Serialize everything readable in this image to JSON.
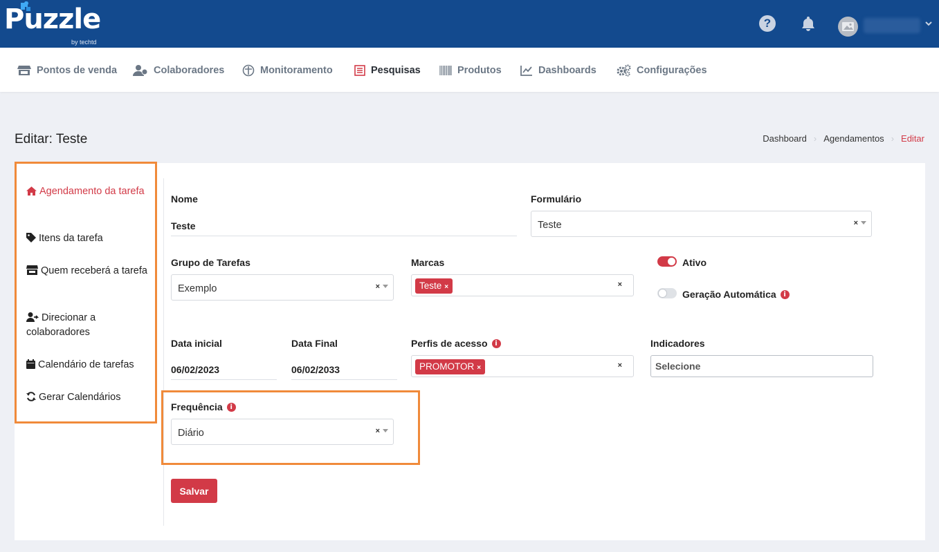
{
  "app": {
    "logo_text": "Puzzle",
    "logo_byline": "by techtd",
    "header_icons": [
      "help-icon",
      "bell-icon",
      "avatar",
      "chevron-down-icon"
    ],
    "help_glyph": "?"
  },
  "nav": {
    "items": [
      {
        "label": "Pontos de venda",
        "icon": "store-icon"
      },
      {
        "label": "Colaboradores",
        "icon": "users-icon"
      },
      {
        "label": "Monitoramento",
        "icon": "monitor-icon"
      },
      {
        "label": "Pesquisas",
        "icon": "survey-icon",
        "active": true
      },
      {
        "label": "Produtos",
        "icon": "barcode-icon"
      },
      {
        "label": "Dashboards",
        "icon": "chart-icon"
      },
      {
        "label": "Configurações",
        "icon": "gears-icon"
      }
    ]
  },
  "page": {
    "title": "Editar: Teste",
    "breadcrumb": [
      "Dashboard",
      "Agendamentos",
      "Editar"
    ]
  },
  "side_menu": {
    "items": [
      {
        "label": "Agendamento da tarefa",
        "icon": "home-icon",
        "active": true
      },
      {
        "label": "Itens da tarefa",
        "icon": "tag-icon"
      },
      {
        "label": "Quem receberá a tarefa",
        "icon": "store-icon"
      },
      {
        "label": "Direcionar a colaboradores",
        "icon": "user-arrow-icon"
      },
      {
        "label": "Calendário de tarefas",
        "icon": "calendar-icon"
      },
      {
        "label": "Gerar Calendários",
        "icon": "refresh-icon"
      }
    ]
  },
  "form": {
    "nome": {
      "label": "Nome",
      "value": "Teste"
    },
    "formulario": {
      "label": "Formulário",
      "value": "Teste"
    },
    "grupo": {
      "label": "Grupo de Tarefas",
      "value": "Exemplo"
    },
    "marcas": {
      "label": "Marcas",
      "tags": [
        "Teste"
      ]
    },
    "ativo": {
      "label": "Ativo",
      "on": true
    },
    "geracao": {
      "label": "Geração Automática",
      "on": false
    },
    "data_inicial": {
      "label": "Data inicial",
      "value": "06/02/2023"
    },
    "data_final": {
      "label": "Data Final",
      "value": "06/02/2033"
    },
    "perfis": {
      "label": "Perfis de acesso",
      "tags": [
        "PROMOTOR"
      ]
    },
    "indicadores": {
      "label": "Indicadores",
      "placeholder": "Selecione"
    },
    "frequencia": {
      "label": "Frequência",
      "value": "Diário"
    },
    "clear_glyph": "×",
    "info_glyph": "i",
    "save_label": "Salvar"
  },
  "colors": {
    "header": "#134a8e",
    "accent": "#d23a47",
    "highlight": "#f08a3a",
    "background": "#eef0f5"
  }
}
